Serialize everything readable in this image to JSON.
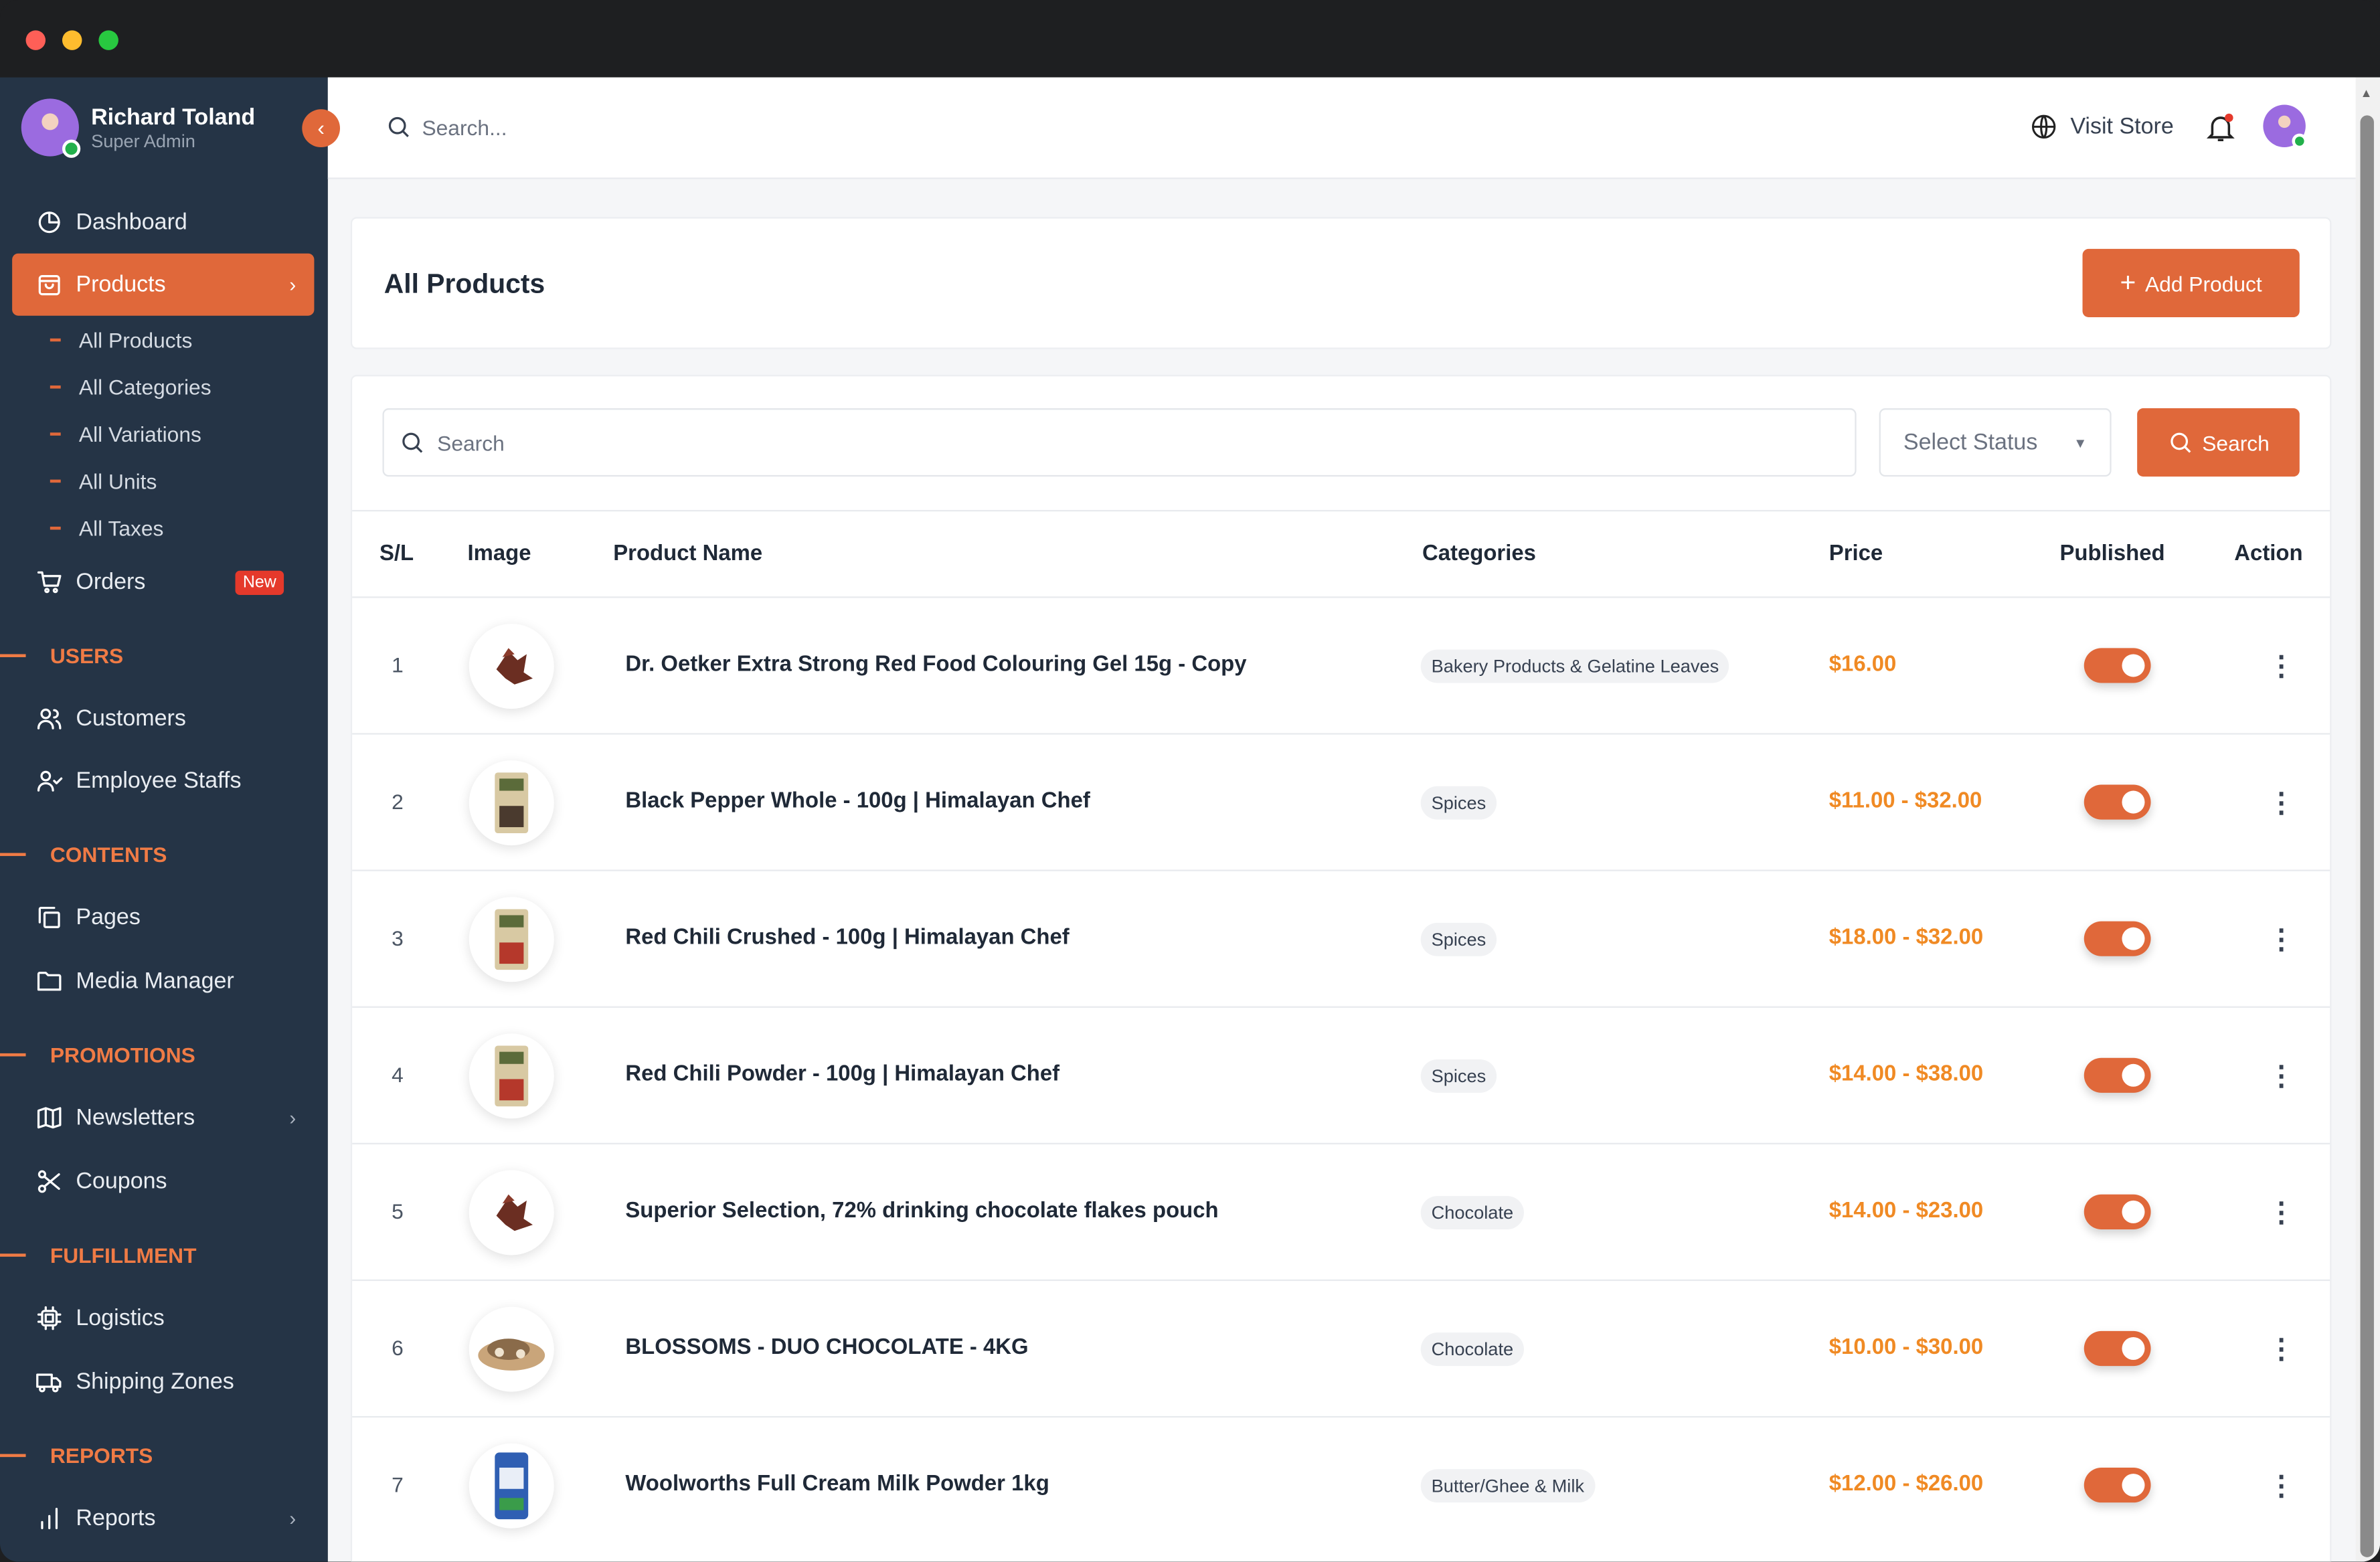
{
  "colors": {
    "accent": "#e0683a",
    "sidebar": "#253446",
    "price": "#f08a24",
    "section": "#f07b45",
    "online": "#22b04b",
    "badge": "#e5392b"
  },
  "user": {
    "name": "Richard Toland",
    "role": "Super Admin"
  },
  "topbar": {
    "search_placeholder": "Search...",
    "visit_store": "Visit Store"
  },
  "sidebar": {
    "dashboard": "Dashboard",
    "products": "Products",
    "sub_items": [
      "All Products",
      "All Categories",
      "All Variations",
      "All Units",
      "All Taxes"
    ],
    "orders": "Orders",
    "orders_badge": "New",
    "sections": {
      "users": "USERS",
      "contents": "CONTENTS",
      "promotions": "PROMOTIONS",
      "fulfillment": "FULFILLMENT",
      "reports": "REPORTS"
    },
    "customers": "Customers",
    "employee_staffs": "Employee Staffs",
    "pages": "Pages",
    "media_manager": "Media Manager",
    "newsletters": "Newsletters",
    "coupons": "Coupons",
    "logistics": "Logistics",
    "shipping_zones": "Shipping Zones",
    "reports": "Reports"
  },
  "page": {
    "title": "All Products",
    "add_button": "Add Product"
  },
  "filters": {
    "search_placeholder": "Search",
    "status_select": "Select Status",
    "search_button": "Search"
  },
  "table": {
    "headers": [
      "S/L",
      "Image",
      "Product Name",
      "Categories",
      "Price",
      "Published",
      "Action"
    ],
    "rows": [
      {
        "sl": "1",
        "name": "Dr. Oetker Extra Strong Red Food Colouring Gel 15g - Copy",
        "category": "Bakery Products & Gelatine Leaves",
        "price": "$16.00",
        "published": true,
        "image": "flakes"
      },
      {
        "sl": "2",
        "name": "Black Pepper Whole - 100g | Himalayan Chef",
        "category": "Spices",
        "price": "$11.00 - $32.00",
        "published": true,
        "image": "pouch-dark"
      },
      {
        "sl": "3",
        "name": "Red Chili Crushed - 100g | Himalayan Chef",
        "category": "Spices",
        "price": "$18.00 - $32.00",
        "published": true,
        "image": "pouch-red"
      },
      {
        "sl": "4",
        "name": "Red Chili Powder - 100g | Himalayan Chef",
        "category": "Spices",
        "price": "$14.00 - $38.00",
        "published": true,
        "image": "pouch-red"
      },
      {
        "sl": "5",
        "name": "Superior Selection, 72% drinking chocolate flakes pouch",
        "category": "Chocolate",
        "price": "$14.00 - $23.00",
        "published": true,
        "image": "flakes"
      },
      {
        "sl": "6",
        "name": "BLOSSOMS - DUO CHOCOLATE - 4KG",
        "category": "Chocolate",
        "price": "$10.00 - $30.00",
        "published": true,
        "image": "pile"
      },
      {
        "sl": "7",
        "name": "Woolworths Full Cream Milk Powder 1kg",
        "category": "Butter/Ghee & Milk",
        "price": "$12.00 - $26.00",
        "published": true,
        "image": "bag-blue"
      }
    ]
  }
}
